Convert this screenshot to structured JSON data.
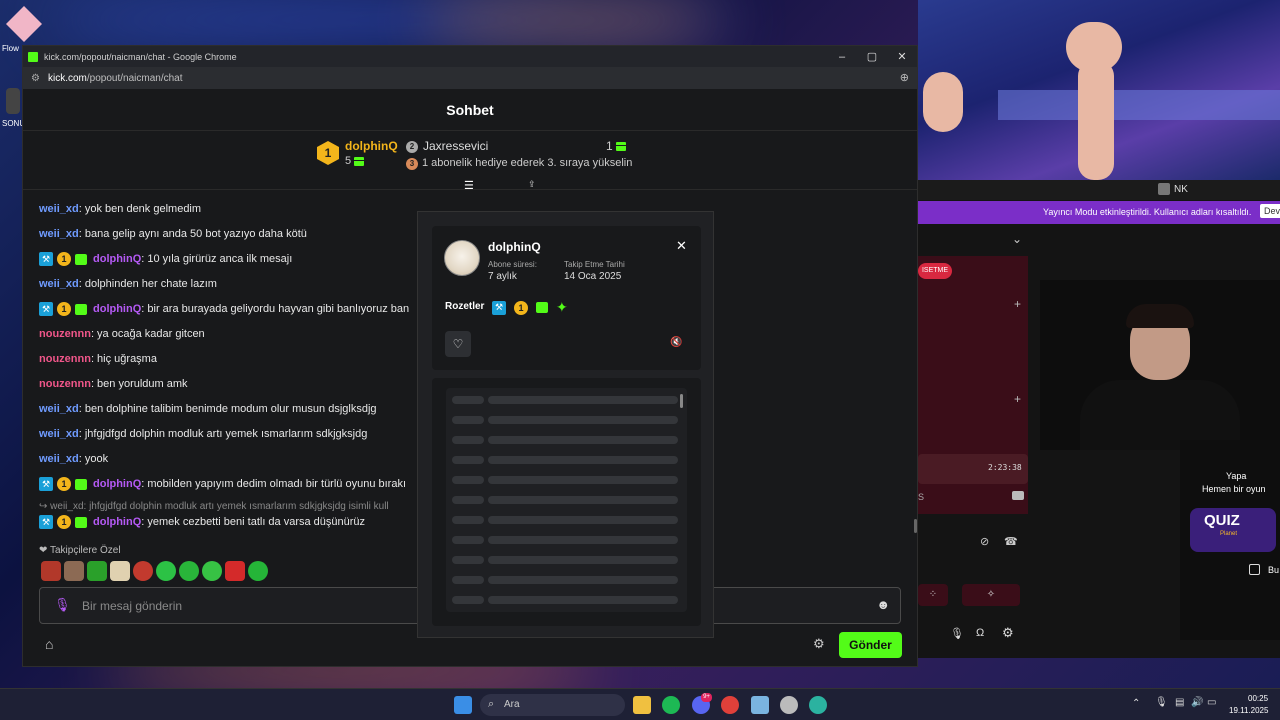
{
  "desktop": {
    "icon1_label": "Flow",
    "icon2_label": "SONU"
  },
  "stream_app": {
    "user_label": "NK",
    "banner_text": "Yayıncı Modu etkinleştirildi. Kullanıcı adları kısaltıldı.",
    "banner_btn": "Dev",
    "tag_label": "ISETME",
    "timestamp": "2:23:38",
    "quiz_text_1": "Yapa",
    "quiz_text_2": "Hemen bir oyun",
    "quiz_logo": "QUIZ",
    "quiz_sub": "Planet",
    "checkbox_label": "Bu"
  },
  "chrome": {
    "window_title": "kick.com/popout/naicman/chat - Google Chrome",
    "url_host": "kick.com",
    "url_path": "/popout/naicman/chat"
  },
  "chat": {
    "title": "Sohbet",
    "leaderboard": {
      "first_name": "dolphinQ",
      "first_rank": "1",
      "first_count": "5",
      "second_name": "Jaxressevici",
      "second_rank": "2",
      "second_count": "1",
      "third_rank": "3",
      "third_text": "1 abonelik hediye ederek 3. sıraya yükselin"
    },
    "messages": [
      {
        "user": "weii_xd",
        "text": ": yok ben denk gelmedim"
      },
      {
        "user": "weii_xd",
        "text": ": bana gelip aynı anda 50 bot yazıyo daha kötü"
      },
      {
        "user": "dolphinQ",
        "text": ": 10 yıla girürüz anca ilk mesajı"
      },
      {
        "user": "weii_xd",
        "text": ": dolphinden her chate lazım"
      },
      {
        "user": "dolphinQ",
        "text": ": bir ara burayada geliyordu hayvan gibi banlıyoruz ban"
      },
      {
        "user": "nouzennn",
        "text": ": ya ocağa kadar gitcen"
      },
      {
        "user": "nouzennn",
        "text": ": hiç uğraşma"
      },
      {
        "user": "nouzennn",
        "text": ": ben yoruldum amk"
      },
      {
        "user": "weii_xd",
        "text": ": ben dolphine talibim benimde modum olur musun dsjglksdjg"
      },
      {
        "user": "weii_xd",
        "text": ": jhfgjdfgd dolphin modluk artı yemek ısmarlarım sdkjgksjdg"
      },
      {
        "user": "weii_xd",
        "text": ": yook"
      },
      {
        "user": "dolphinQ",
        "text": ": mobilden yapıyım dedim olmadı bir türlü oyunu bırakı"
      },
      {
        "user": "dolphinQ",
        "text": ": yemek cezbetti beni tatlı da varsa düşünürüz"
      }
    ],
    "badge_one": "1",
    "reply_preview": "weii_xd: jhfgjdfgd dolphin modluk artı yemek ısmarlarım sdkjgksjdg isimli kull",
    "followers_only_label": "Takipçilere Özel",
    "input_placeholder": "Bir mesaj gönderin",
    "send_label": "Gönder"
  },
  "profile_popup": {
    "username": "dolphinQ",
    "sub_duration_label": "Abone süresi:",
    "sub_duration_value": "7 aylık",
    "follow_date_label": "Takip Etme Tarihi",
    "follow_date_value": "14 Oca 2025",
    "badges_label": "Rozetler",
    "badge_one": "1"
  },
  "taskbar": {
    "search_placeholder": "Ara",
    "time": "00:25",
    "date": "19.11.2025",
    "discord_badge": "9+"
  }
}
